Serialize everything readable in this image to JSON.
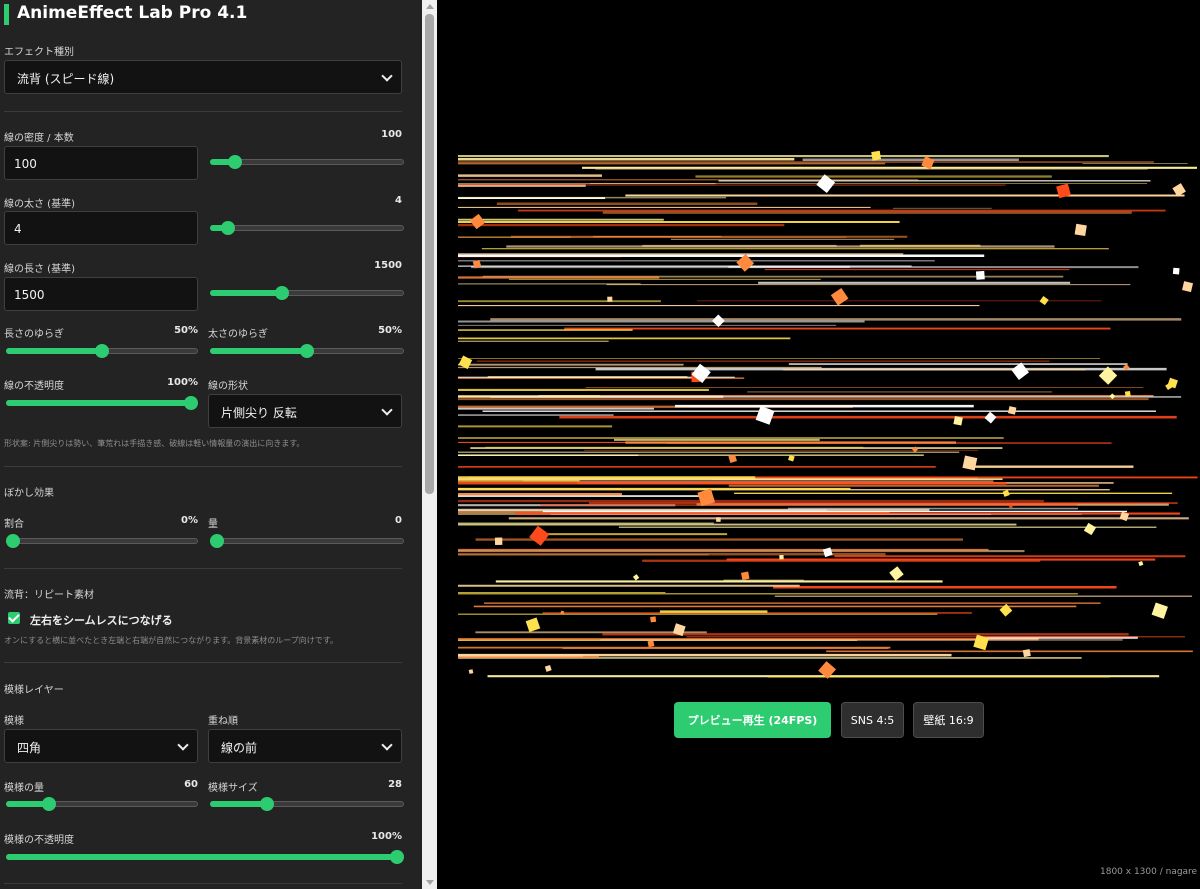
{
  "app": {
    "title": "AnimeEffect Lab Pro 4.1"
  },
  "sidebar": {
    "effect_type": {
      "label": "エフェクト種別",
      "selected": "流背 (スピード線)"
    },
    "density": {
      "label": "線の密度 / 本数",
      "value_text": "100",
      "input": "100",
      "value": 100,
      "min": 0,
      "max": 1000
    },
    "thickness": {
      "label": "線の太さ (基準)",
      "value_text": "4",
      "input": "4",
      "value": 4,
      "min": 1,
      "max": 50
    },
    "length": {
      "label": "線の長さ (基準)",
      "value_text": "1500",
      "input": "1500",
      "value": 1500,
      "min": 100,
      "max": 4000
    },
    "length_jitter": {
      "label": "長さのゆらぎ",
      "value_text": "50%",
      "value": 50,
      "min": 0,
      "max": 100
    },
    "thickness_jitter": {
      "label": "太さのゆらぎ",
      "value_text": "50%",
      "value": 50,
      "min": 0,
      "max": 100
    },
    "opacity": {
      "label": "線の不透明度",
      "value_text": "100%",
      "value": 100,
      "min": 0,
      "max": 100
    },
    "shape": {
      "label": "線の形状",
      "selected": "片側尖り 反転"
    },
    "shape_hint": "形状案: 片側尖りは勢い、筆荒れは手描き感、破線は軽い情報量の演出に向きます。",
    "blur": {
      "section": "ぼかし効果",
      "ratio": {
        "label": "割合",
        "value_text": "0%",
        "value": 0,
        "min": 0,
        "max": 100
      },
      "amount": {
        "label": "量",
        "value_text": "0",
        "value": 0,
        "min": 0,
        "max": 20
      }
    },
    "repeat": {
      "section": "流背：リピート素材",
      "checkbox_label": "左右をシームレスにつなげる",
      "checked": true,
      "hint": "オンにすると横に並べたとき左端と右端が自然につながります。背景素材のループ向けです。"
    },
    "pattern": {
      "section": "模様レイヤー",
      "pattern_label": "模様",
      "pattern_selected": "四角",
      "order_label": "重ね順",
      "order_selected": "線の前",
      "amount": {
        "label": "模様の量",
        "value_text": "60",
        "value": 60,
        "min": 0,
        "max": 300
      },
      "size": {
        "label": "模様サイズ",
        "value_text": "28",
        "value": 28,
        "min": 0,
        "max": 100
      },
      "opacity": {
        "label": "模様の不透明度",
        "value_text": "100%",
        "value": 100,
        "min": 0,
        "max": 100
      }
    }
  },
  "stage": {
    "play_button": "プレビュー再生 (24FPS)",
    "sns_button": "SNS 4:5",
    "wallpaper_button": "壁紙 16:9",
    "footer": "1800 x 1300 / nagare"
  },
  "colors": {
    "accent": "#2ecc71",
    "line_palette": [
      "#ffffff",
      "#fff3a0",
      "#ffe14d",
      "#ff8a3d",
      "#ff4a1c",
      "#ffd6a0"
    ]
  }
}
